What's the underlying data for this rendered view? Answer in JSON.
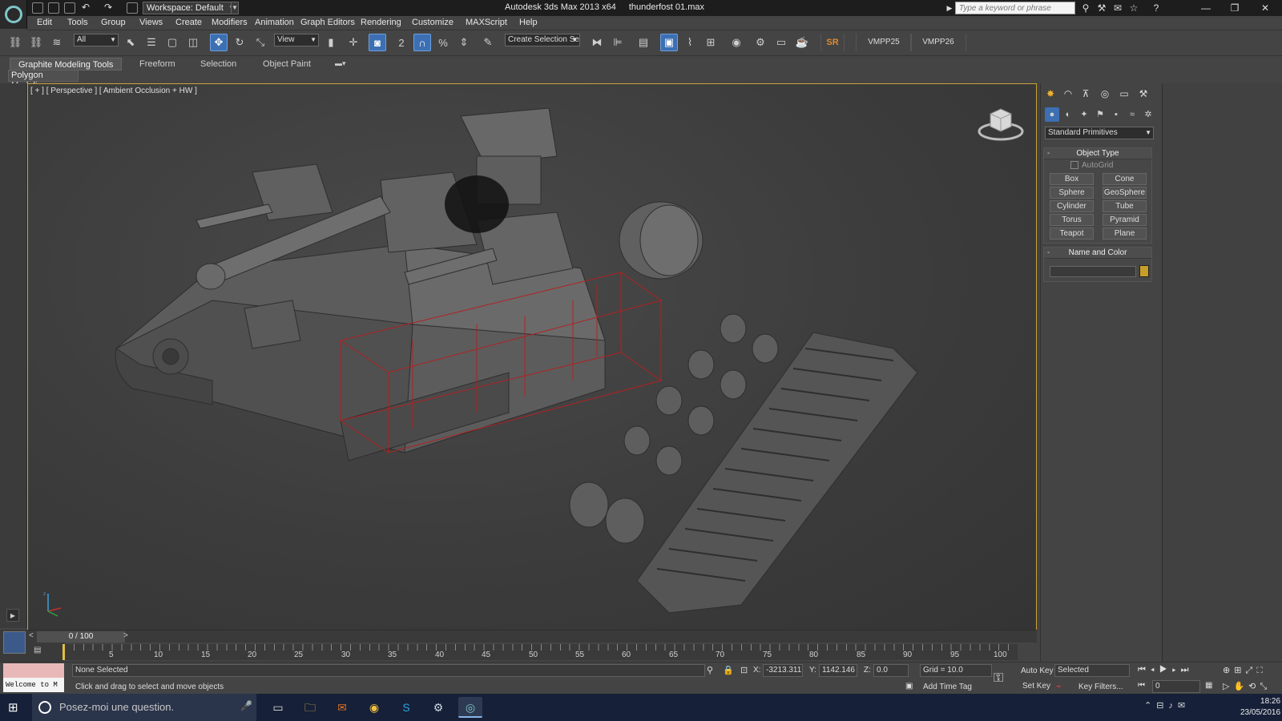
{
  "titlebar": {
    "workspace": "Workspace: Default",
    "app_name": "Autodesk 3ds Max  2013 x64",
    "file_name": "thunderfost 01.max",
    "search_placeholder": "Type a keyword or phrase"
  },
  "menu": [
    "Edit",
    "Tools",
    "Group",
    "Views",
    "Create",
    "Modifiers",
    "Animation",
    "Graph Editors",
    "Rendering",
    "Customize",
    "MAXScript",
    "Help"
  ],
  "toolbar": {
    "selection_filter": "All",
    "ref_coord": "View",
    "selection_set": "Create Selection Se",
    "percent_snap": "%",
    "angle_snap": "2",
    "sr_label": "SR",
    "vmpp25": "VMPP25",
    "vmpp26": "VMPP26"
  },
  "ribbon": {
    "tabs": [
      "Graphite Modeling Tools",
      "Freeform",
      "Selection",
      "Object Paint"
    ],
    "panel_label": "Polygon Modeling"
  },
  "viewport": {
    "label": "[ + ] [ Perspective ] [ Ambient Occlusion + HW ]",
    "axis_x": "x",
    "axis_y": "y",
    "axis_z": "z"
  },
  "command_panel": {
    "category": "Standard Primitives",
    "object_type_title": "Object Type",
    "autogrid": "AutoGrid",
    "buttons": [
      "Box",
      "Cone",
      "Sphere",
      "GeoSphere",
      "Cylinder",
      "Tube",
      "Torus",
      "Pyramid",
      "Teapot",
      "Plane"
    ],
    "name_color_title": "Name and Color",
    "object_color": "#c89e2a"
  },
  "timeline": {
    "frame_label": "0 / 100",
    "ticks": [
      "5",
      "10",
      "15",
      "20",
      "25",
      "30",
      "35",
      "40",
      "45",
      "50",
      "55",
      "60",
      "65",
      "70",
      "75",
      "80",
      "85",
      "90",
      "95",
      "100"
    ]
  },
  "status": {
    "listener": "Welcome to M",
    "selection": "None Selected",
    "prompt": "Click and drag to select and move objects",
    "x_label": "X:",
    "x_value": "-3213.311",
    "y_label": "Y:",
    "y_value": "1142.146",
    "z_label": "Z:",
    "z_value": "0.0",
    "grid": "Grid = 10.0",
    "add_time_tag": "Add Time Tag",
    "auto_key": "Auto Key",
    "set_key": "Set Key",
    "key_mode": "Selected",
    "key_filters": "Key Filters...",
    "current_frame": "0"
  },
  "taskbar": {
    "search_text": "Posez-moi une question.",
    "time": "18:26",
    "date": "23/05/2016"
  }
}
